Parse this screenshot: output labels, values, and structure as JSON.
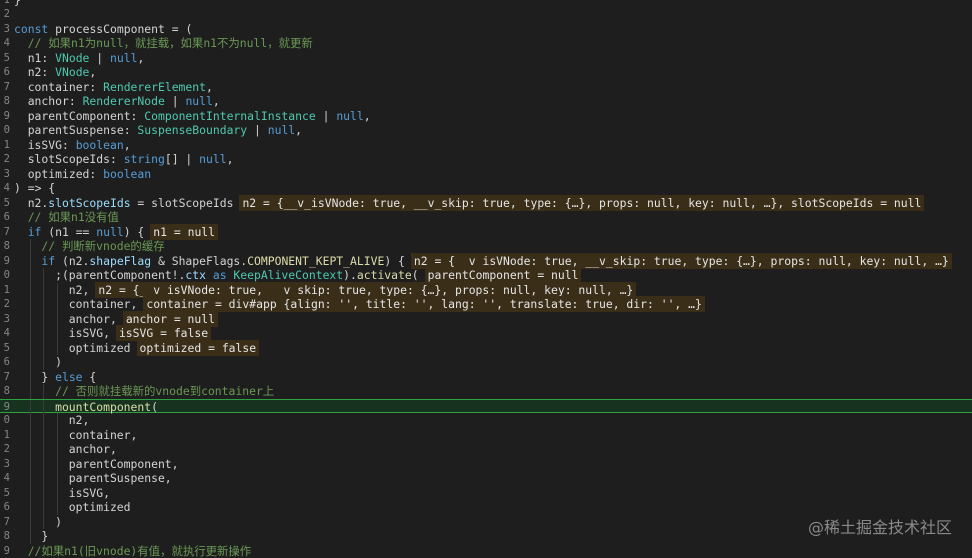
{
  "editor": {
    "lines": [
      {
        "n": "1",
        "indent": 0,
        "tokens": [
          {
            "t": "}",
            "c": "va"
          }
        ]
      },
      {
        "n": "2",
        "indent": 0,
        "tokens": []
      },
      {
        "n": "3",
        "indent": 0,
        "tokens": [
          {
            "t": "const ",
            "c": "kw"
          },
          {
            "t": "processComponent = (",
            "c": "va"
          }
        ]
      },
      {
        "n": "4",
        "indent": 1,
        "tokens": [
          {
            "t": "// 如果n1为null，就挂载，如果n1不为null，就更新",
            "c": "cm"
          }
        ]
      },
      {
        "n": "5",
        "indent": 1,
        "tokens": [
          {
            "t": "n1: ",
            "c": "va"
          },
          {
            "t": "VNode",
            "c": "ty"
          },
          {
            "t": " | ",
            "c": "va"
          },
          {
            "t": "null",
            "c": "kw"
          },
          {
            "t": ",",
            "c": "va"
          }
        ]
      },
      {
        "n": "6",
        "indent": 1,
        "tokens": [
          {
            "t": "n2: ",
            "c": "va"
          },
          {
            "t": "VNode",
            "c": "ty"
          },
          {
            "t": ",",
            "c": "va"
          }
        ]
      },
      {
        "n": "7",
        "indent": 1,
        "tokens": [
          {
            "t": "container: ",
            "c": "va"
          },
          {
            "t": "RendererElement",
            "c": "ty"
          },
          {
            "t": ",",
            "c": "va"
          }
        ]
      },
      {
        "n": "8",
        "indent": 1,
        "tokens": [
          {
            "t": "anchor: ",
            "c": "va"
          },
          {
            "t": "RendererNode",
            "c": "ty"
          },
          {
            "t": " | ",
            "c": "va"
          },
          {
            "t": "null",
            "c": "kw"
          },
          {
            "t": ",",
            "c": "va"
          }
        ]
      },
      {
        "n": "9",
        "indent": 1,
        "tokens": [
          {
            "t": "parentComponent: ",
            "c": "va"
          },
          {
            "t": "ComponentInternalInstance",
            "c": "ty"
          },
          {
            "t": " | ",
            "c": "va"
          },
          {
            "t": "null",
            "c": "kw"
          },
          {
            "t": ",",
            "c": "va"
          }
        ]
      },
      {
        "n": "0",
        "indent": 1,
        "tokens": [
          {
            "t": "parentSuspense: ",
            "c": "va"
          },
          {
            "t": "SuspenseBoundary",
            "c": "ty"
          },
          {
            "t": " | ",
            "c": "va"
          },
          {
            "t": "null",
            "c": "kw"
          },
          {
            "t": ",",
            "c": "va"
          }
        ]
      },
      {
        "n": "1",
        "indent": 1,
        "tokens": [
          {
            "t": "isSVG: ",
            "c": "va"
          },
          {
            "t": "boolean",
            "c": "kw"
          },
          {
            "t": ",",
            "c": "va"
          }
        ]
      },
      {
        "n": "2",
        "indent": 1,
        "tokens": [
          {
            "t": "slotScopeIds: ",
            "c": "va"
          },
          {
            "t": "string",
            "c": "kw"
          },
          {
            "t": "[] | ",
            "c": "va"
          },
          {
            "t": "null",
            "c": "kw"
          },
          {
            "t": ",",
            "c": "va"
          }
        ]
      },
      {
        "n": "3",
        "indent": 1,
        "tokens": [
          {
            "t": "optimized: ",
            "c": "va"
          },
          {
            "t": "boolean",
            "c": "kw"
          }
        ]
      },
      {
        "n": "4",
        "indent": 0,
        "tokens": [
          {
            "t": ") => {",
            "c": "va"
          }
        ]
      },
      {
        "n": "5",
        "indent": 1,
        "tokens": [
          {
            "t": "n2.",
            "c": "va"
          },
          {
            "t": "slotScopeIds",
            "c": "pr"
          },
          {
            "t": " = slotScopeIds",
            "c": "va"
          }
        ],
        "inline": "n2 = {__v_isVNode: true, __v_skip: true, type: {…}, props: null, key: null, …}, slotScopeIds = null"
      },
      {
        "n": "6",
        "indent": 1,
        "tokens": [
          {
            "t": "// 如果n1没有值",
            "c": "cm"
          }
        ]
      },
      {
        "n": "7",
        "indent": 1,
        "tokens": [
          {
            "t": "if ",
            "c": "kw"
          },
          {
            "t": "(n1 == ",
            "c": "va"
          },
          {
            "t": "null",
            "c": "kw"
          },
          {
            "t": ") {",
            "c": "va"
          }
        ],
        "inline": "n1 = null"
      },
      {
        "n": "8",
        "indent": 2,
        "tokens": [
          {
            "t": "// 判断新vnode的缓存",
            "c": "cm"
          }
        ]
      },
      {
        "n": "9",
        "indent": 2,
        "tokens": [
          {
            "t": "if ",
            "c": "kw"
          },
          {
            "t": "(n2.",
            "c": "va"
          },
          {
            "t": "shapeFlag",
            "c": "pr"
          },
          {
            "t": " & ShapeFlags.",
            "c": "va"
          },
          {
            "t": "COMPONENT_KEPT_ALIVE",
            "c": "fn"
          },
          {
            "t": ") {",
            "c": "va"
          }
        ],
        "inline": "n2 = {__v_isVNode: true, __v_skip: true, type: {…}, props: null, key: null, …}"
      },
      {
        "n": "0",
        "indent": 3,
        "tokens": [
          {
            "t": ";(parentComponent!.",
            "c": "va"
          },
          {
            "t": "ctx",
            "c": "pr"
          },
          {
            "t": " as ",
            "c": "kw"
          },
          {
            "t": "KeepAliveContext",
            "c": "ty"
          },
          {
            "t": ").",
            "c": "va"
          },
          {
            "t": "activate",
            "c": "fn"
          },
          {
            "t": "(",
            "c": "va"
          }
        ],
        "inline": "parentComponent = null"
      },
      {
        "n": "1",
        "indent": 4,
        "tokens": [
          {
            "t": "n2,",
            "c": "va"
          }
        ],
        "inline": "n2 = {__v_isVNode: true, __v_skip: true, type: {…}, props: null, key: null, …}"
      },
      {
        "n": "2",
        "indent": 4,
        "tokens": [
          {
            "t": "container,",
            "c": "va"
          }
        ],
        "inline": "container = div#app {align: '', title: '', lang: '', translate: true, dir: '', …}"
      },
      {
        "n": "3",
        "indent": 4,
        "tokens": [
          {
            "t": "anchor,",
            "c": "va"
          }
        ],
        "inline": "anchor = null"
      },
      {
        "n": "4",
        "indent": 4,
        "tokens": [
          {
            "t": "isSVG,",
            "c": "va"
          }
        ],
        "inline": "isSVG = false"
      },
      {
        "n": "5",
        "indent": 4,
        "tokens": [
          {
            "t": "optimized",
            "c": "va"
          }
        ],
        "inline": "optimized = false"
      },
      {
        "n": "6",
        "indent": 3,
        "tokens": [
          {
            "t": ")",
            "c": "va"
          }
        ]
      },
      {
        "n": "7",
        "indent": 2,
        "tokens": [
          {
            "t": "} ",
            "c": "va"
          },
          {
            "t": "else",
            "c": "kw"
          },
          {
            "t": " {",
            "c": "va"
          }
        ]
      },
      {
        "n": "8",
        "indent": 3,
        "tokens": [
          {
            "t": "// 否则就挂载新的vnode到container上",
            "c": "cm"
          }
        ]
      },
      {
        "n": "9",
        "indent": 3,
        "tokens": [
          {
            "t": "mountComponent",
            "c": "fn"
          },
          {
            "t": "(",
            "c": "va"
          }
        ],
        "current": true
      },
      {
        "n": "0",
        "indent": 4,
        "tokens": [
          {
            "t": "n2,",
            "c": "va"
          }
        ]
      },
      {
        "n": "1",
        "indent": 4,
        "tokens": [
          {
            "t": "container,",
            "c": "va"
          }
        ]
      },
      {
        "n": "2",
        "indent": 4,
        "tokens": [
          {
            "t": "anchor,",
            "c": "va"
          }
        ]
      },
      {
        "n": "3",
        "indent": 4,
        "tokens": [
          {
            "t": "parentComponent,",
            "c": "va"
          }
        ]
      },
      {
        "n": "4",
        "indent": 4,
        "tokens": [
          {
            "t": "parentSuspense,",
            "c": "va"
          }
        ]
      },
      {
        "n": "5",
        "indent": 4,
        "tokens": [
          {
            "t": "isSVG,",
            "c": "va"
          }
        ]
      },
      {
        "n": "6",
        "indent": 4,
        "tokens": [
          {
            "t": "optimized",
            "c": "va"
          }
        ]
      },
      {
        "n": "7",
        "indent": 3,
        "tokens": [
          {
            "t": ")",
            "c": "va"
          }
        ]
      },
      {
        "n": "8",
        "indent": 2,
        "tokens": [
          {
            "t": "}",
            "c": "va"
          }
        ]
      },
      {
        "n": "9",
        "indent": 1,
        "tokens": [
          {
            "t": "//如果n1(旧vnode)有值，就执行更新操作",
            "c": "cm"
          }
        ]
      }
    ]
  },
  "watermark": "@稀土掘金技术社区",
  "colors": {
    "background": "#1e1e1e",
    "current_line_border": "#2ea043",
    "inline_value_bg": "#3b2e19"
  }
}
